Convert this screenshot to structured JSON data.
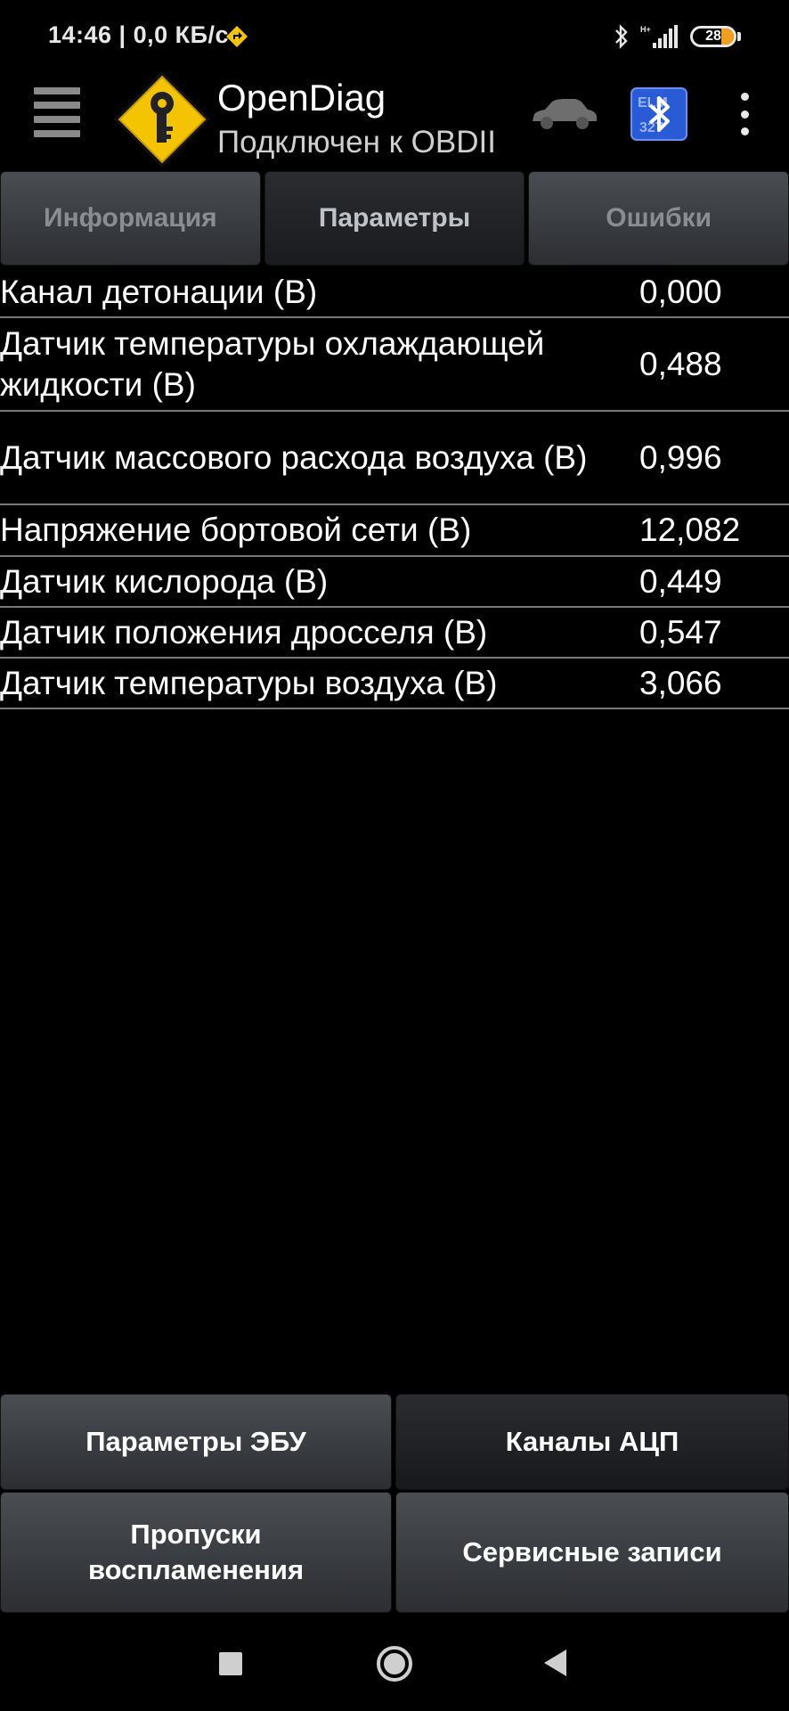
{
  "status": {
    "time_speed": "14:46 | 0,0 КБ/с",
    "battery": "28"
  },
  "app": {
    "title": "OpenDiag",
    "subtitle": "Подключен к OBDII"
  },
  "tabs": [
    {
      "label": "Информация",
      "active": false
    },
    {
      "label": "Параметры",
      "active": true
    },
    {
      "label": "Ошибки",
      "active": false
    }
  ],
  "params": [
    {
      "name": "Канал детонации (В)",
      "value": "0,000"
    },
    {
      "name": "Датчик температуры охлаждающей жидкости (В)",
      "value": "0,488"
    },
    {
      "name": "Датчик массового расхода воздуха (В)",
      "value": "0,996"
    },
    {
      "name": "Напряжение бортовой сети (В)",
      "value": "12,082"
    },
    {
      "name": "Датчик кислорода (В)",
      "value": "0,449"
    },
    {
      "name": "Датчик положения дросселя (В)",
      "value": "0,547"
    },
    {
      "name": "Датчик температуры воздуха (В)",
      "value": "3,066"
    }
  ],
  "buttons": {
    "ecu_params": "Параметры ЭБУ",
    "adc_channels": "Каналы АЦП",
    "misfires": "Пропуски воспламенения",
    "service_records": "Сервисные записи"
  },
  "colors": {
    "background": "#000000",
    "tab_text_inactive": "#8a8d92",
    "logo_yellow": "#f5c400",
    "bluetooth_blue": "#2a5bd7",
    "battery_orange": "#f0a020"
  },
  "icons": {
    "menu": "hamburger-menu-icon",
    "logo": "key-diamond-logo-icon",
    "car": "car-icon",
    "bluetooth": "bluetooth-elm-icon",
    "more": "more-vertical-icon"
  }
}
